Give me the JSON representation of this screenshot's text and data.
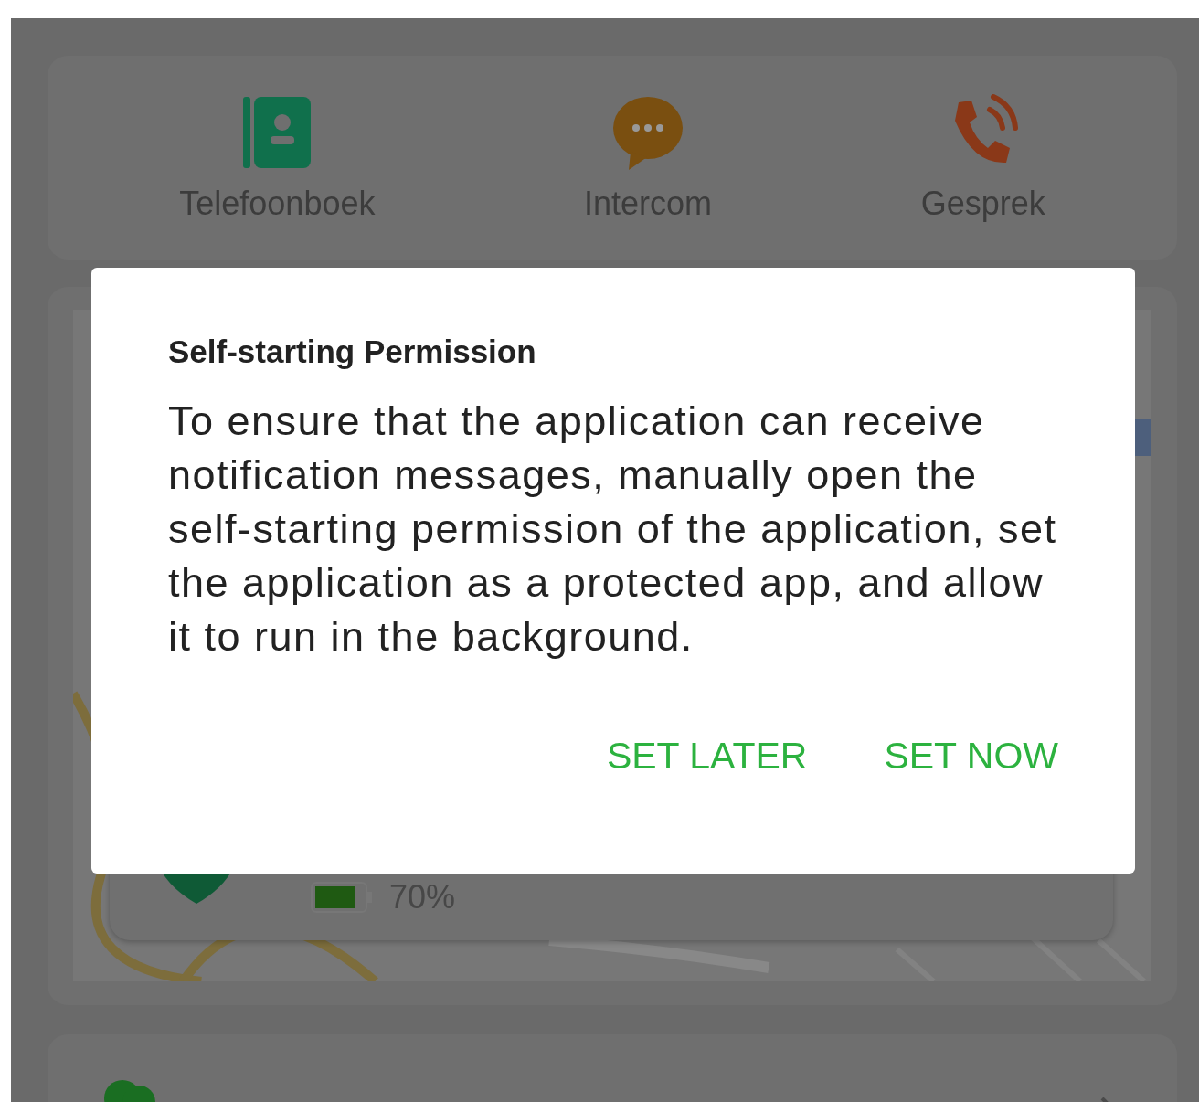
{
  "shortcuts": [
    {
      "label": "Telefoonboek",
      "kind": "phonebook"
    },
    {
      "label": "Intercom",
      "kind": "intercom"
    },
    {
      "label": "Gesprek",
      "kind": "call"
    }
  ],
  "device_card": {
    "battery": "70%"
  },
  "dialog": {
    "title": "Self-starting Permission",
    "message": "To ensure that the application can receive notification messages, manually open the self-starting permission of the application, set the application as a protected app, and allow it to run in the background.",
    "buttons": [
      "SET LATER",
      "SET NOW"
    ]
  }
}
